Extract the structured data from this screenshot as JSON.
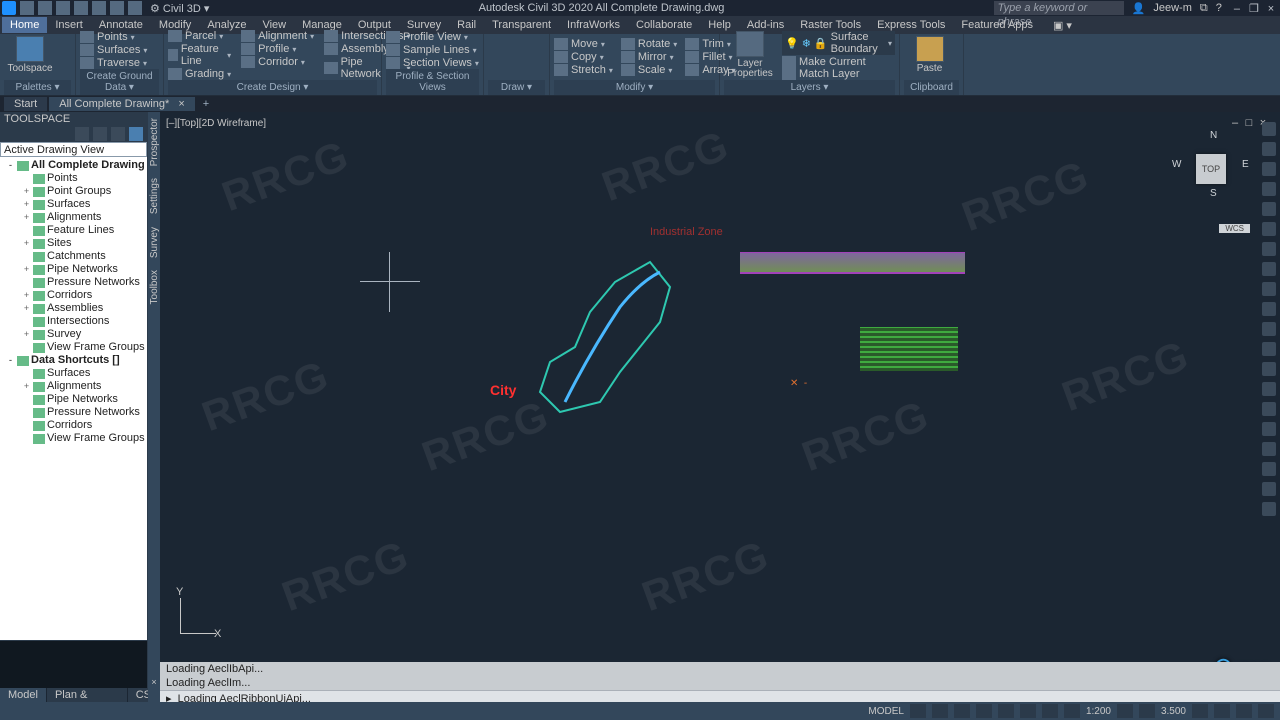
{
  "app": {
    "product_selector": "Civil 3D",
    "title_center": "Autodesk Civil 3D 2020   All Complete Drawing.dwg",
    "search_placeholder": "Type a keyword or phrase",
    "user": "Jeew-m"
  },
  "menu": {
    "items": [
      "Home",
      "Insert",
      "Annotate",
      "Modify",
      "Analyze",
      "View",
      "Manage",
      "Output",
      "Survey",
      "Rail",
      "Transparent",
      "InfraWorks",
      "Collaborate",
      "Help",
      "Add-ins",
      "Raster Tools",
      "Express Tools",
      "Featured Apps"
    ],
    "active": "Home"
  },
  "ribbon": {
    "palettes": {
      "big": "Toolspace",
      "title": "Palettes ▾"
    },
    "ground": {
      "items": [
        "Points",
        "Surfaces",
        "Traverse"
      ],
      "title": "Create Ground Data ▾"
    },
    "design": {
      "col1": [
        "Parcel",
        "Feature Line",
        "Grading"
      ],
      "col2": [
        "Alignment",
        "Profile",
        "Corridor"
      ],
      "col3": [
        "Intersections",
        "Assembly",
        "Pipe Network"
      ],
      "title": "Create Design ▾"
    },
    "profile": {
      "items": [
        "Profile View",
        "Sample Lines",
        "Section Views"
      ],
      "title": "Profile & Section Views"
    },
    "draw": {
      "title": "Draw ▾"
    },
    "modify": {
      "col1": [
        "Move",
        "Copy",
        "Stretch"
      ],
      "col2": [
        "Rotate",
        "Mirror",
        "Scale"
      ],
      "col3": [
        "Trim",
        "Fillet",
        "Array"
      ],
      "title": "Modify ▾"
    },
    "layers": {
      "big": "Layer Properties",
      "combo": "Surface Boundary",
      "items": [
        "Make Current",
        "Match Layer"
      ],
      "title": "Layers ▾"
    },
    "clipboard": {
      "big": "Paste",
      "title": "Clipboard"
    }
  },
  "doctabs": {
    "start": "Start",
    "current": "All Complete Drawing*",
    "close": "×"
  },
  "toolspace": {
    "title": "TOOLSPACE",
    "combo": "Active Drawing View",
    "rails": [
      "Prospector",
      "Settings",
      "Survey",
      "Toolbox"
    ],
    "tree": [
      {
        "t": "All Complete Drawing",
        "b": true,
        "i": 0,
        "exp": "-"
      },
      {
        "t": "Points",
        "i": 1
      },
      {
        "t": "Point Groups",
        "i": 1,
        "exp": "+"
      },
      {
        "t": "Surfaces",
        "i": 1,
        "exp": "+"
      },
      {
        "t": "Alignments",
        "i": 1,
        "exp": "+"
      },
      {
        "t": "Feature Lines",
        "i": 1
      },
      {
        "t": "Sites",
        "i": 1,
        "exp": "+"
      },
      {
        "t": "Catchments",
        "i": 1
      },
      {
        "t": "Pipe Networks",
        "i": 1,
        "exp": "+"
      },
      {
        "t": "Pressure Networks",
        "i": 1
      },
      {
        "t": "Corridors",
        "i": 1,
        "exp": "+"
      },
      {
        "t": "Assemblies",
        "i": 1,
        "exp": "+"
      },
      {
        "t": "Intersections",
        "i": 1
      },
      {
        "t": "Survey",
        "i": 1,
        "exp": "+"
      },
      {
        "t": "View Frame Groups",
        "i": 1
      },
      {
        "t": "Data Shortcuts []",
        "b": true,
        "i": 0,
        "exp": "-"
      },
      {
        "t": "Surfaces",
        "i": 1
      },
      {
        "t": "Alignments",
        "i": 1,
        "exp": "+"
      },
      {
        "t": "Pipe Networks",
        "i": 1
      },
      {
        "t": "Pressure Networks",
        "i": 1
      },
      {
        "t": "Corridors",
        "i": 1
      },
      {
        "t": "View Frame Groups",
        "i": 1
      }
    ]
  },
  "canvas": {
    "viewlabel": "[–][Top][2D Wireframe]",
    "cube": {
      "face": "TOP",
      "n": "N",
      "s": "S",
      "e": "E",
      "w": "W"
    },
    "wcs": "WCS",
    "ucs": {
      "x": "X",
      "y": "Y"
    },
    "labels": {
      "city": "City",
      "zone": "Industrial Zone"
    }
  },
  "command": {
    "hist1": "Loading AeclIbApi...",
    "hist2": "Loading AeclIm...",
    "line": "Loading AeclRibbonUiApi..."
  },
  "bottomtabs": [
    "Model",
    "Plan & Profile",
    "CS"
  ],
  "status": {
    "model": "MODEL",
    "scale": "1:200",
    "val": "3.500"
  },
  "win": {
    "min": "–",
    "max": "□",
    "restore": "❐",
    "close": "×"
  },
  "watermark": "RRCG"
}
